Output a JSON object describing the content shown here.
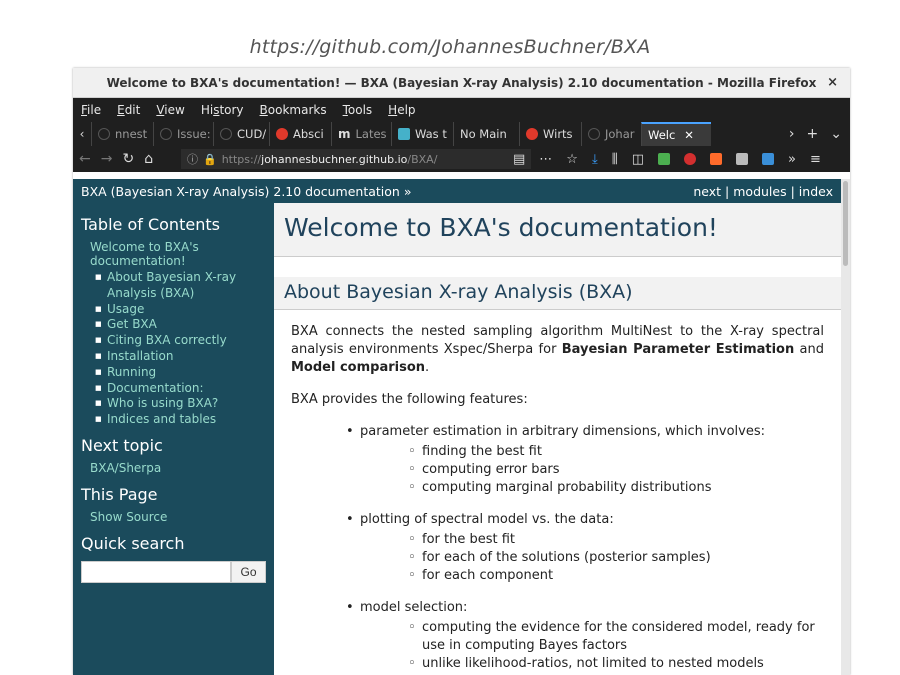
{
  "caption": "https://github.com/JohannesBuchner/BXA",
  "window": {
    "title": "Welcome to BXA's documentation! — BXA (Bayesian X-ray Analysis) 2.10 documentation - Mozilla Firefox",
    "close": "×"
  },
  "menu": [
    {
      "u": "F",
      "rest": "ile"
    },
    {
      "u": "E",
      "rest": "dit"
    },
    {
      "u": "V",
      "rest": "iew"
    },
    {
      "pre": "Hi",
      "u": "s",
      "rest": "tory"
    },
    {
      "u": "B",
      "rest": "ookmarks"
    },
    {
      "u": "T",
      "rest": "ools"
    },
    {
      "u": "H",
      "rest": "elp"
    }
  ],
  "tabs": [
    {
      "label": "nnest",
      "icon": "github-icon",
      "color": "#333333"
    },
    {
      "label": "Issue:",
      "icon": "github-icon",
      "color": "#333333"
    },
    {
      "label": "CUD/",
      "icon": "github-icon",
      "color": "#333333"
    },
    {
      "label": "Absci",
      "icon": "opera-icon",
      "color": "#e0392b"
    },
    {
      "label": "Lates",
      "icon": "m-icon",
      "color": "#ffffff"
    },
    {
      "label": "Was t",
      "icon": "chat-icon",
      "color": "#45b1c9"
    },
    {
      "label": "No Main",
      "icon": "none",
      "color": ""
    },
    {
      "label": "Wirts",
      "icon": "opera-icon",
      "color": "#e0392b"
    },
    {
      "label": "Johar",
      "icon": "github-icon",
      "color": "#333333"
    },
    {
      "label": "Welc",
      "icon": "none",
      "color": "",
      "active": true
    }
  ],
  "tab_controls": {
    "next": "›",
    "new": "+",
    "list": "⌄"
  },
  "nav": {
    "url_proto": "https://",
    "url_host": "johannesbuchner.github.io",
    "url_path": "/BXA/"
  },
  "related": {
    "title": "BXA (Bayesian X-ray Analysis) 2.10 documentation »",
    "next": "next",
    "modules": "modules",
    "index": "index",
    "sep": "|"
  },
  "sidebar": {
    "toc_heading": "Table of Contents",
    "toc_top": "Welcome to BXA's documentation!",
    "toc_items": [
      "About Bayesian X-ray Analysis (BXA)",
      "Usage",
      "Get BXA",
      "Citing BXA correctly",
      "Installation",
      "Running",
      "Documentation:",
      "Who is using BXA?",
      "Indices and tables"
    ],
    "next_heading": "Next topic",
    "next_link": "BXA/Sherpa",
    "page_heading": "This Page",
    "show_source": "Show Source",
    "search_heading": "Quick search",
    "search_button": "Go"
  },
  "main": {
    "title": "Welcome to BXA's documentation!",
    "subtitle": "About Bayesian X-ray Analysis (BXA)",
    "intro_a": "BXA connects the nested sampling algorithm MultiNest to the X-ray spectral analysis environments Xspec/Sherpa for ",
    "intro_b1": "Bayesian Parameter Estimation",
    "intro_mid": " and ",
    "intro_b2": "Model comparison",
    "intro_end": ".",
    "features_lead": "BXA provides the following features:",
    "features": [
      {
        "text": "parameter estimation in arbitrary dimensions, which involves:",
        "sub": [
          "finding the best fit",
          "computing error bars",
          "computing marginal probability distributions"
        ]
      },
      {
        "text": "plotting of spectral model vs. the data:",
        "sub": [
          "for the best fit",
          "for each of the solutions (posterior samples)",
          "for each component"
        ]
      },
      {
        "text": "model selection:",
        "sub": [
          "computing the evidence for the considered model, ready for use in computing Bayes factors",
          "unlike likelihood-ratios, not limited to nested models"
        ]
      }
    ]
  }
}
